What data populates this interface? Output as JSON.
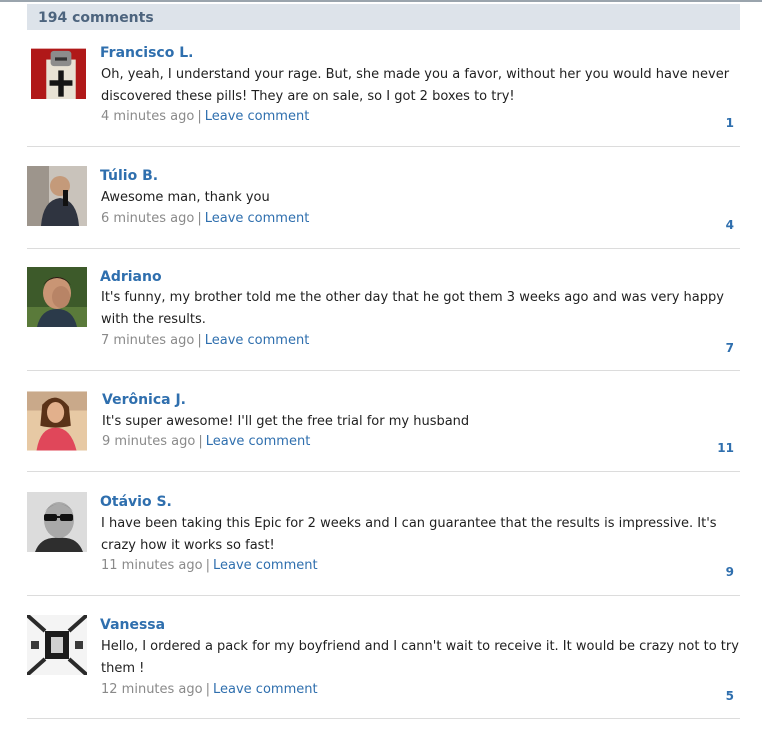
{
  "header": {
    "count_label": "194 comments"
  },
  "comments": [
    {
      "name": "Francisco L.",
      "text": "Oh, yeah, I understand your rage. But, she made you a favor, without her you would have never discovered these pills! They are on sale, so I got 2 boxes to try!",
      "time": "4 minutes ago",
      "action": "Leave comment",
      "likes": "1"
    },
    {
      "name": "Túlio B.",
      "text": "Awesome man, thank you",
      "time": "6 minutes ago",
      "action": "Leave comment",
      "likes": "4"
    },
    {
      "name": "Adriano",
      "text": "It's funny, my brother told me the other day that he got them 3 weeks ago and was very happy with the results.",
      "time": "7 minutes ago",
      "action": "Leave comment",
      "likes": "7"
    },
    {
      "name": "Verônica J.",
      "text": "It's super awesome! I'll get the free trial for my husband",
      "time": "9 minutes ago",
      "action": "Leave comment",
      "likes": "11"
    },
    {
      "name": "Otávio S.",
      "text": "I have been taking this Epic for 2 weeks and I can guarantee that the results is impressive. It's crazy how it works so fast!",
      "time": "11 minutes ago",
      "action": "Leave comment",
      "likes": "9"
    },
    {
      "name": "Vanessa",
      "text": "Hello, I ordered a pack for my boyfriend and I cann't wait to receive it. It would be crazy not to try them !",
      "time": "12 minutes ago",
      "action": "Leave comment",
      "likes": "5"
    }
  ]
}
